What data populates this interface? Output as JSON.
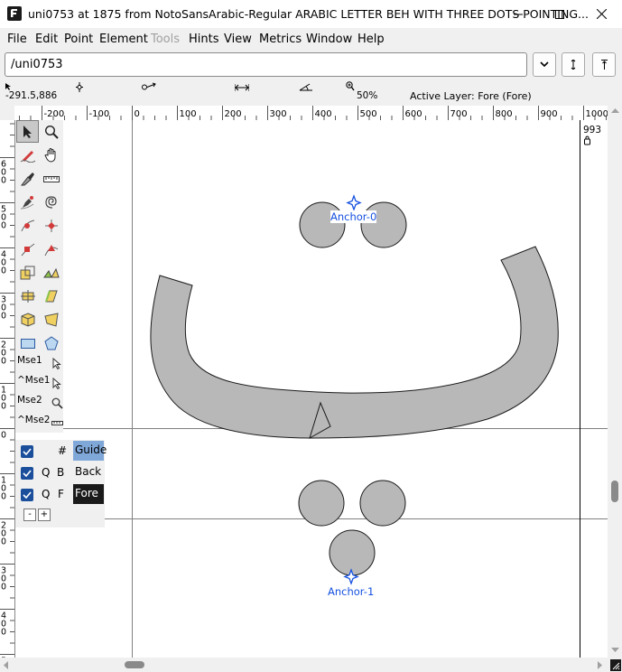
{
  "window": {
    "title": "uni0753 at 1875 from NotoSansArabic-Regular ARABIC LETTER BEH WITH THREE DOTS POINTING..."
  },
  "menu": {
    "file": "File",
    "edit": "Edit",
    "point": "Point",
    "element": "Element",
    "tools": "Tools",
    "hints": "Hints",
    "view": "View",
    "metrics": "Metrics",
    "window": "Window",
    "help": "Help"
  },
  "glyph_field": {
    "value": "/uni0753"
  },
  "info": {
    "coords": "-291.5,886",
    "zoom": "50%",
    "active_layer": "Active Layer: Fore (Fore)"
  },
  "ruler": {
    "h_ticks": [
      "-200",
      "-100",
      "0",
      "100",
      "200",
      "300",
      "400",
      "500",
      "600",
      "700",
      "800",
      "900",
      "1000"
    ],
    "v_ticks": [
      "6\n0\n0",
      "5\n0\n0",
      "4\n0\n0",
      "3\n0\n0",
      "2\n0\n0",
      "1\n0\n0",
      "0",
      "1\n0\n0",
      "2\n0\n0",
      "3\n0\n0",
      "4\n0\n0",
      "5\n0\n0"
    ]
  },
  "canvas": {
    "advance_width_label": "993",
    "anchor_top": "Anchor-0",
    "anchor_bottom": "Anchor-1"
  },
  "toolbox": {
    "mse1": "Mse1",
    "ctrl_mse1": "^Mse1",
    "mse2": "Mse2",
    "ctrl_mse2": "^Mse2"
  },
  "layers": {
    "rows": [
      {
        "visible": true,
        "type": "",
        "kind": "#",
        "name": "Guide"
      },
      {
        "visible": true,
        "type": "Q",
        "kind": "B",
        "name": "Back"
      },
      {
        "visible": true,
        "type": "Q",
        "kind": "F",
        "name": "Fore"
      }
    ],
    "remove_label": "-",
    "add_label": "+"
  },
  "colors": {
    "glyph_fill": "#b8b8b8",
    "anchor_blue": "#1550e0",
    "guide_highlight": "#7fa7d8",
    "fore_highlight": "#1a1a1a",
    "checkbox_blue": "#1b4f9c"
  }
}
